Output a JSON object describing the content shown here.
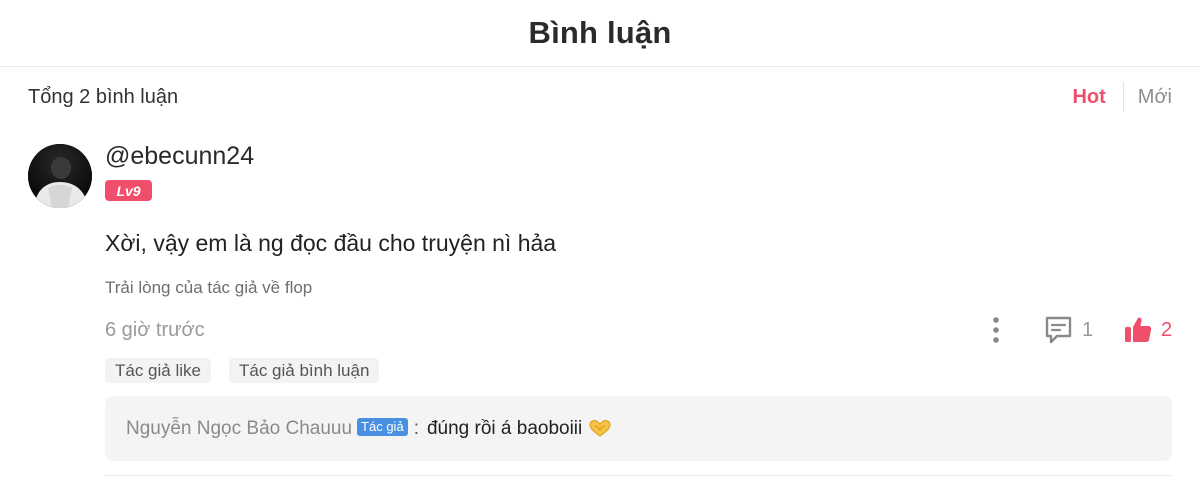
{
  "header": {
    "title": "Bình luận"
  },
  "summary": {
    "total_label": "Tổng 2 bình luận"
  },
  "sort_tabs": [
    {
      "label": "Hot",
      "active": true
    },
    {
      "label": "Mới",
      "active": false
    }
  ],
  "comment": {
    "username": "@ebecunn24",
    "level": "Lv9",
    "text": "Xời, vậy em là ng đọc đầu cho truyện nì hảa",
    "chapter": "Trải lòng của tác giả về flop",
    "time": "6 giờ trước",
    "reply_count": "1",
    "like_count": "2",
    "tags": [
      "Tác giả like",
      "Tác giả bình luận"
    ],
    "reply": {
      "author": "Nguyễn Ngọc Bảo Chauuu",
      "author_badge": "Tác giả",
      "separator": ":",
      "text": "đúng rồi á baoboiii",
      "emoji": "heart-hands-emoji"
    }
  },
  "icons": {
    "more": "more-vertical-icon",
    "reply": "comment-icon",
    "like": "thumbs-up-icon"
  },
  "colors": {
    "accent": "#ef4f6a",
    "author_badge": "#4a90e2",
    "muted_text": "#9a9a9a",
    "reply_bg": "#f4f4f4"
  }
}
